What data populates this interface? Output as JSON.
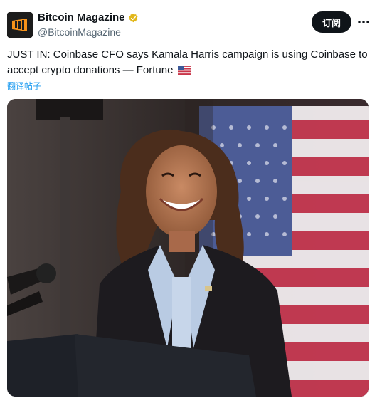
{
  "author": {
    "display_name": "Bitcoin Magazine",
    "handle": "@BitcoinMagazine",
    "verified_badge": "gold-check-icon",
    "avatar_icon": "bitcoin-magazine-logo-icon"
  },
  "actions": {
    "subscribe_label": "订阅",
    "more_icon": "more-horizontal-icon"
  },
  "post": {
    "text": "JUST IN: Coinbase CFO says Kamala Harris campaign is using Coinbase to accept crypto donations — Fortune",
    "flag_icon": "us-flag-emoji",
    "translate_label": "翻译帖子"
  },
  "media": {
    "type": "photo"
  },
  "colors": {
    "accent": "#1d9bf0",
    "gold": "#e2b719",
    "button_bg": "#0f1419",
    "handle": "#536471"
  }
}
